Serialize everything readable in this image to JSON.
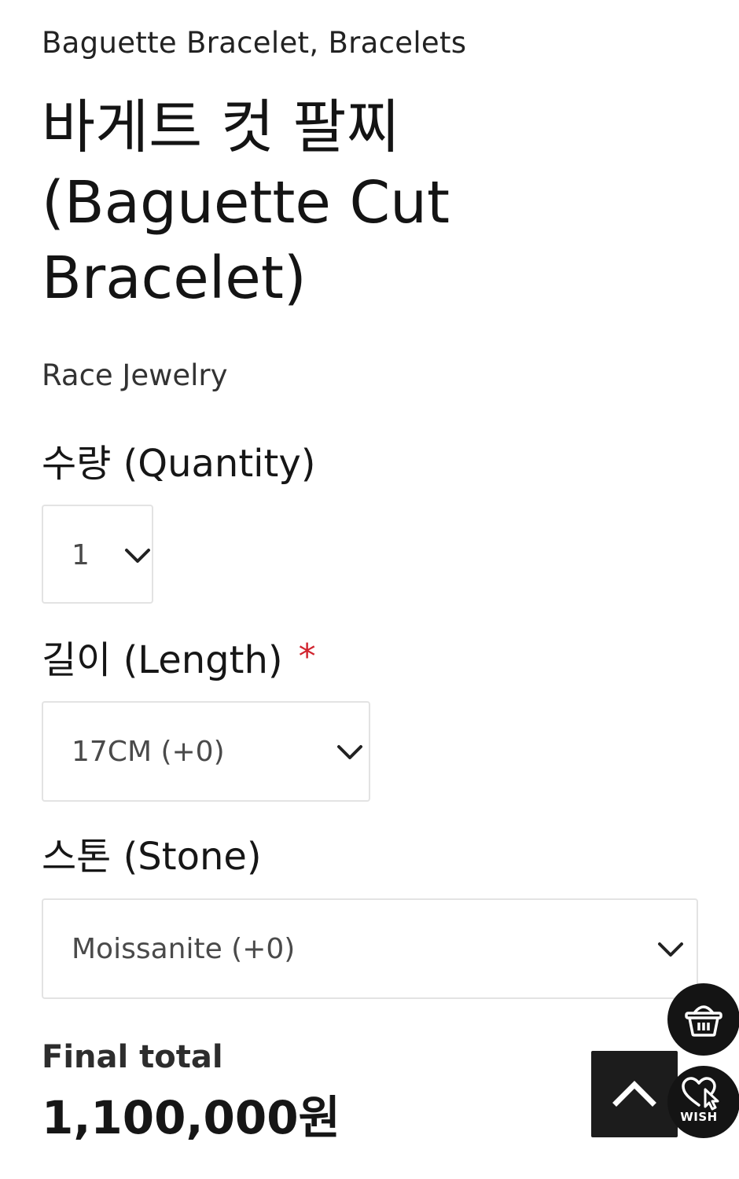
{
  "breadcrumb": "Baguette Bracelet, Bracelets",
  "product": {
    "title_line1": "바게트 컷 팔찌",
    "title_line2": "(Baguette Cut",
    "title_line3": "Bracelet)",
    "brand": "Race Jewelry"
  },
  "quantity": {
    "label": "수량 (Quantity)",
    "value": "1"
  },
  "length": {
    "label": "길이 (Length)",
    "required_mark": "*",
    "value": "17CM (+0)"
  },
  "stone": {
    "label": "스톤 (Stone)",
    "value": "Moissanite (+0)"
  },
  "total": {
    "label": "Final total",
    "value": "1,100,000원"
  },
  "floating": {
    "wish_label": "WISH",
    "cart_icon": "shopping-basket-icon",
    "wish_icon": "heart-cursor-icon",
    "scroll_icon": "chevron-up-icon"
  },
  "colors": {
    "required": "#d1242f",
    "fab_background": "#141414",
    "text": "#161616"
  }
}
